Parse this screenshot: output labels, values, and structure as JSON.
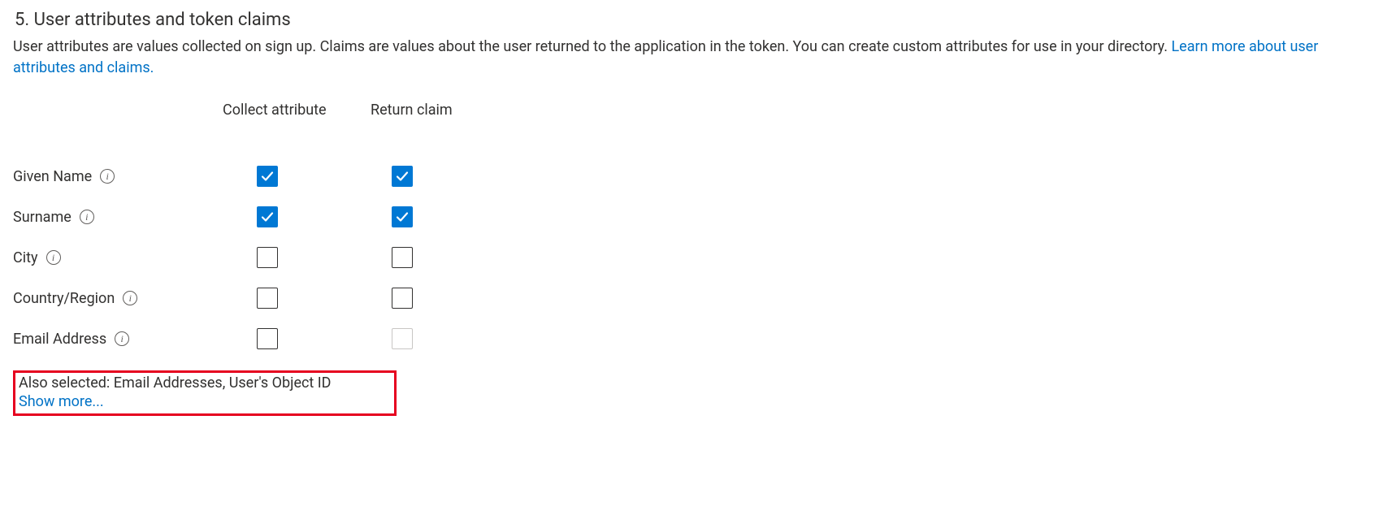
{
  "section": {
    "title": "5. User attributes and token claims",
    "description_prefix": "User attributes are values collected on sign up. Claims are values about the user returned to the application in the token. You can create custom attributes for use in your directory. ",
    "learn_more_label": "Learn more about user attributes and claims."
  },
  "columns": {
    "collect": "Collect attribute",
    "return": "Return claim"
  },
  "rows": [
    {
      "label": "Given Name",
      "collect": true,
      "return": true,
      "return_disabled": false
    },
    {
      "label": "Surname",
      "collect": true,
      "return": true,
      "return_disabled": false
    },
    {
      "label": "City",
      "collect": false,
      "return": false,
      "return_disabled": false
    },
    {
      "label": "Country/Region",
      "collect": false,
      "return": false,
      "return_disabled": false
    },
    {
      "label": "Email Address",
      "collect": false,
      "return": false,
      "return_disabled": true
    }
  ],
  "footer": {
    "also_selected": "Also selected: Email Addresses, User's Object ID",
    "show_more": "Show more..."
  },
  "icons": {
    "info_glyph": "i"
  }
}
